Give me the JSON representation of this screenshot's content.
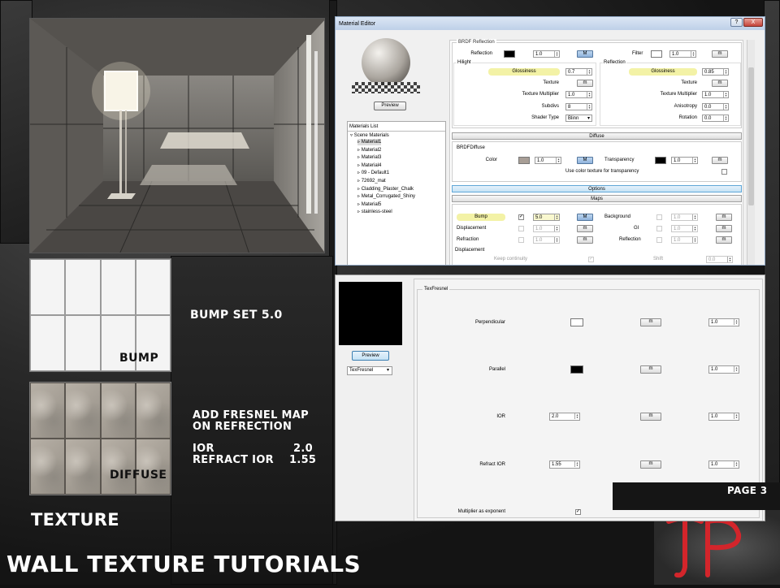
{
  "page_title": "WALL TEXTURE TUTORIALS",
  "page_number": "PAGE 3",
  "section_texture": "TEXTURE",
  "bump_swatch_label": "BUMP",
  "diffuse_swatch_label": "DIFFUSE",
  "notes": {
    "bump": "BUMP SET 5.0",
    "fresnel_line1": "ADD FRESNEL MAP",
    "fresnel_line2": "ON REFRECTION",
    "ior_label": "IOR",
    "ior_value": "2.0",
    "refract_label": "REFRACT IOR",
    "refract_value": "1.55"
  },
  "logo_text": "TP",
  "colors": {
    "accent_red": "#d3252b",
    "highlight_yellow": "#f3f2a6"
  },
  "material_editor": {
    "title": "Material Editor",
    "title_buttons": [
      "?",
      "X"
    ],
    "preview_button": "Preview",
    "materials_list_title": "Materials List",
    "scene_materials_label": "Scene Materials",
    "materials": [
      "Material1",
      "Material2",
      "Material3",
      "Material4",
      "09 - Default1",
      "72692_mat",
      "Cladding_Plaster_Chalk",
      "Metal_Corrugated_Shiny",
      "Material5",
      "stainless-steel"
    ],
    "selected_material": "Material1",
    "brdf_reflection_header": "BRDF Reflection",
    "reflection_label": "Reflection",
    "reflection_value": "1.0",
    "filter_label": "Filter",
    "filter_value": "1.0",
    "hilight_label": "Hilight",
    "reflection_sub_label": "Reflection",
    "glossiness_label": "Glossiness",
    "hilight_glossiness": "0.7",
    "refl_glossiness": "0.85",
    "texture_label": "Texture",
    "texture_multiplier_label": "Texture Multiplier",
    "hilight_tex_mult": "1.0",
    "refl_tex_mult": "1.0",
    "subdivs_label": "Subdivs",
    "subdivs_value": "8",
    "anisotropy_label": "Anisotropy",
    "anisotropy_value": "0.0",
    "shader_type_label": "Shader Type",
    "shader_type_value": "Blinn",
    "rotation_label": "Rotation",
    "rotation_value": "0.0",
    "diffuse_header": "Diffuse",
    "brdf_diffuse_label": "BRDFDiffuse",
    "color_label": "Color",
    "color_value": "1.0",
    "transparency_label": "Transparency",
    "transparency_value": "1.0",
    "use_color_tex_label": "Use color texture for transparency",
    "options_header": "Options",
    "maps_header": "Maps",
    "bump_label": "Bump",
    "bump_value": "5.0",
    "background_label": "Background",
    "background_value": "1.0",
    "displacement_label": "Displacement",
    "displacement_value": "1.0",
    "gi_label": "GI",
    "gi_value": "1.0",
    "refraction_label": "Refraction",
    "refraction_value": "1.0",
    "reflection_map_label": "Reflection",
    "reflection_map_value": "1.0",
    "displacement_section_label": "Displacement",
    "keep_continuity_label": "Keep continuity",
    "shift_label": "Shift",
    "shift_value": "0.0",
    "m": "m",
    "M": "M",
    "colors": {
      "color_swatch": "#a89e96",
      "reflection_swatch": "#000000",
      "filter_swatch": "#ffffff",
      "transparency_swatch": "#000000"
    }
  },
  "texfresnel": {
    "preview_button": "Preview",
    "type_select": "TexFresnel",
    "group_label": "TexFresnel",
    "perpendicular_label": "Perpendicular",
    "perpendicular_value": "1.0",
    "parallel_label": "Parallel",
    "parallel_value": "1.0",
    "ior_label": "IOR",
    "ior_value": "2.0",
    "ior_mult": "1.0",
    "refract_ior_label": "Refract IOR",
    "refract_ior_value": "1.55",
    "refract_ior_mult": "1.0",
    "multiplier_exp_label": "Multiplier as exponent",
    "m": "m",
    "colors": {
      "perpendicular_swatch": "#ffffff",
      "parallel_swatch": "#000000"
    }
  }
}
